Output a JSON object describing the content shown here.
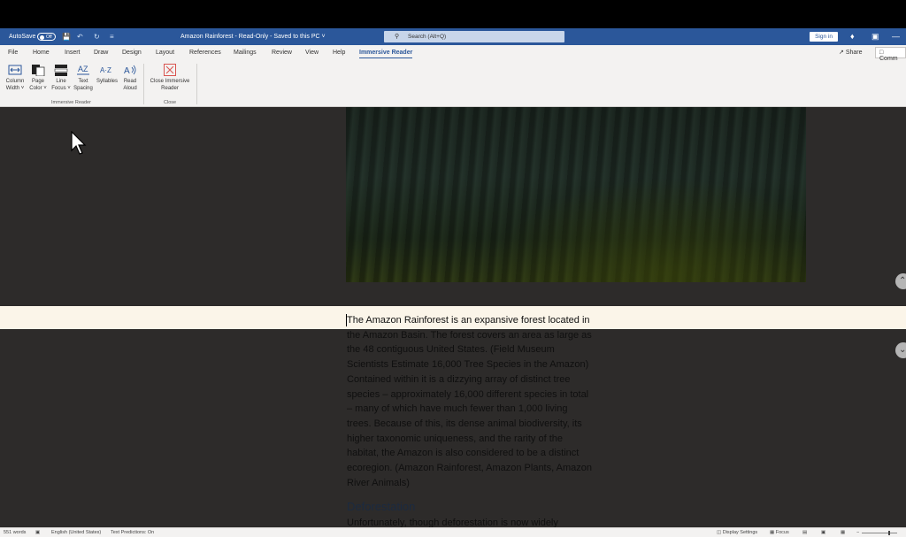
{
  "titlebar": {
    "autosave_label": "AutoSave",
    "autosave_state": "Off",
    "document_title": "Amazon Rainforest  -  Read-Only  -  Saved to this PC ˅",
    "search_placeholder": "Search (Alt+Q)",
    "signin_label": "Sign in"
  },
  "ribbon_tabs": [
    "File",
    "Home",
    "Insert",
    "Draw",
    "Design",
    "Layout",
    "References",
    "Mailings",
    "Review",
    "View",
    "Help",
    "Immersive Reader"
  ],
  "active_tab": "Immersive Reader",
  "share_label": "Share",
  "comments_label": "Comm",
  "ribbon": {
    "column_width": {
      "line1": "Column",
      "line2": "Width ˅"
    },
    "page_color": {
      "line1": "Page",
      "line2": "Color ˅"
    },
    "line_focus": {
      "line1": "Line",
      "line2": "Focus ˅"
    },
    "text_spacing": {
      "line1": "Text",
      "line2": "Spacing"
    },
    "syllables": {
      "line1": "Syllables"
    },
    "read_aloud": {
      "line1": "Read",
      "line2": "Aloud"
    },
    "close_reader": {
      "line1": "Close Immersive",
      "line2": "Reader"
    },
    "group_immersive": "Immersive Reader",
    "group_close": "Close"
  },
  "document": {
    "first_line": "The Amazon Rainforest is an expansive forest located in",
    "lines": [
      "the Amazon Basin.  The forest covers an area as large as",
      "the 48 contiguous United States. (Field Museum",
      "Scientists Estimate 16,000 Tree Species in the Amazon)",
      "Contained within it is a dizzying array of distinct tree",
      "species – approximately 16,000 different species in total",
      "– many of which have much fewer than 1,000 living",
      "trees.  Because of this, its dense animal biodiversity, its",
      "higher taxonomic uniqueness, and the rarity of the",
      "habitat, the Amazon is also considered to be a distinct",
      "ecoregion. (Amazon Rainforest, Amazon Plants, Amazon",
      "River Animals)"
    ],
    "heading": "Deforestation",
    "next_line": "Unfortunately, though deforestation is now widely"
  },
  "statusbar": {
    "words": "551 words",
    "language": "English (United States)",
    "predictions": "Text Predictions: On",
    "display_settings": "Display Settings",
    "focus": "Focus"
  },
  "colors": {
    "title_bar": "#2b579a",
    "canvas": "#2d2b2a",
    "line_focus_band": "#fbf5e9",
    "heading": "#1b2a40"
  }
}
